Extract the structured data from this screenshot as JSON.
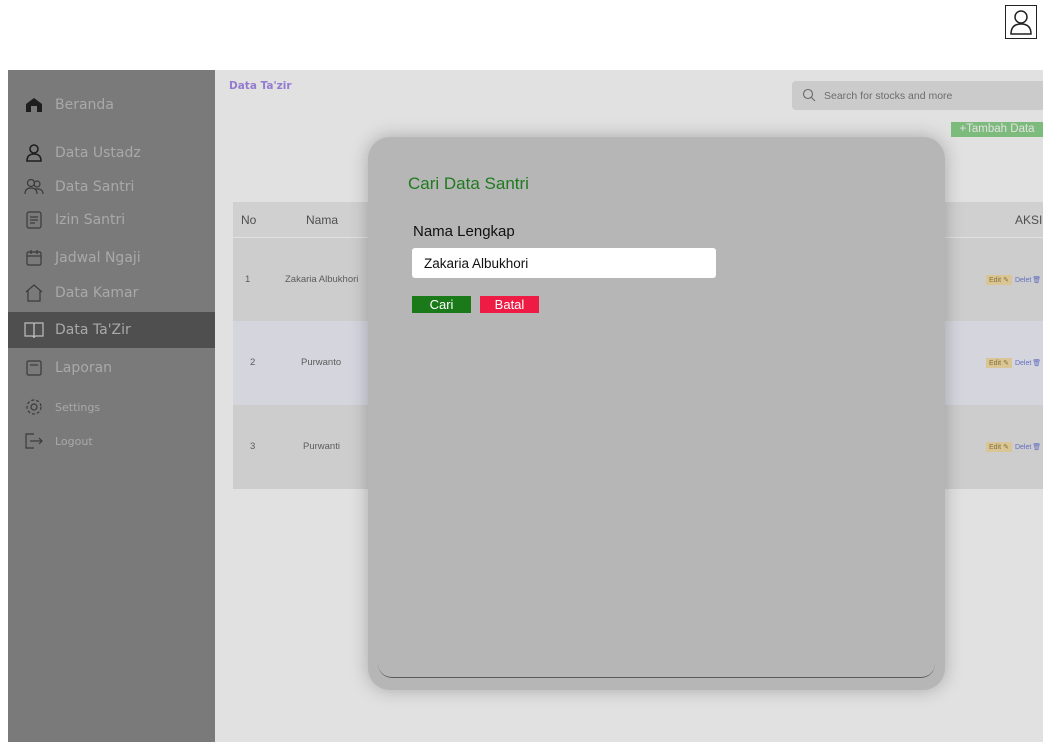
{
  "header": {
    "user_icon": "user-icon"
  },
  "sidebar": {
    "items": [
      {
        "label": "Beranda",
        "icon": "home-icon"
      },
      {
        "label": "Data Ustadz",
        "icon": "user-icon"
      },
      {
        "label": "Data Santri",
        "icon": "users-icon"
      },
      {
        "label": "Izin Santri",
        "icon": "document-icon"
      },
      {
        "label": "Jadwal Ngaji",
        "icon": "calendar-icon"
      },
      {
        "label": "Data Kamar",
        "icon": "house-icon"
      },
      {
        "label": "Data Ta'Zir",
        "icon": "book-icon",
        "active": true
      },
      {
        "label": "Laporan",
        "icon": "report-icon"
      },
      {
        "label": "Settings",
        "icon": "gear-icon"
      },
      {
        "label": "Logout",
        "icon": "logout-icon"
      }
    ]
  },
  "main": {
    "title": "Data Ta'zir",
    "search": {
      "placeholder": "Search for stocks and more",
      "icon": "search-icon"
    },
    "add_button": "+Tambah Data",
    "table": {
      "headers": {
        "no": "No",
        "nama": "Nama",
        "aksi": "AKSI"
      },
      "rows": [
        {
          "no": "1",
          "nama": "Zakaria Albukhori"
        },
        {
          "no": "2",
          "nama": "Purwanto"
        },
        {
          "no": "3",
          "nama": "Purwanti"
        }
      ],
      "edit_label": "Edit",
      "delete_label": "Delet"
    }
  },
  "modal": {
    "title": "Cari Data Santri",
    "field_label": "Nama Lengkap",
    "field_value": "Zakaria Albukhori",
    "search_button": "Cari",
    "cancel_button": "Batal"
  },
  "colors": {
    "sidebar_bg": "#7a7a7a",
    "sidebar_active": "#4f4f4f",
    "modal_bg": "#b6b6b6",
    "title_green": "#1f7a1f",
    "search_green": "#1a7a1a",
    "cancel_red": "#ee1c45",
    "accent_purple": "#9b7de8",
    "add_green": "#7fcf7f"
  }
}
